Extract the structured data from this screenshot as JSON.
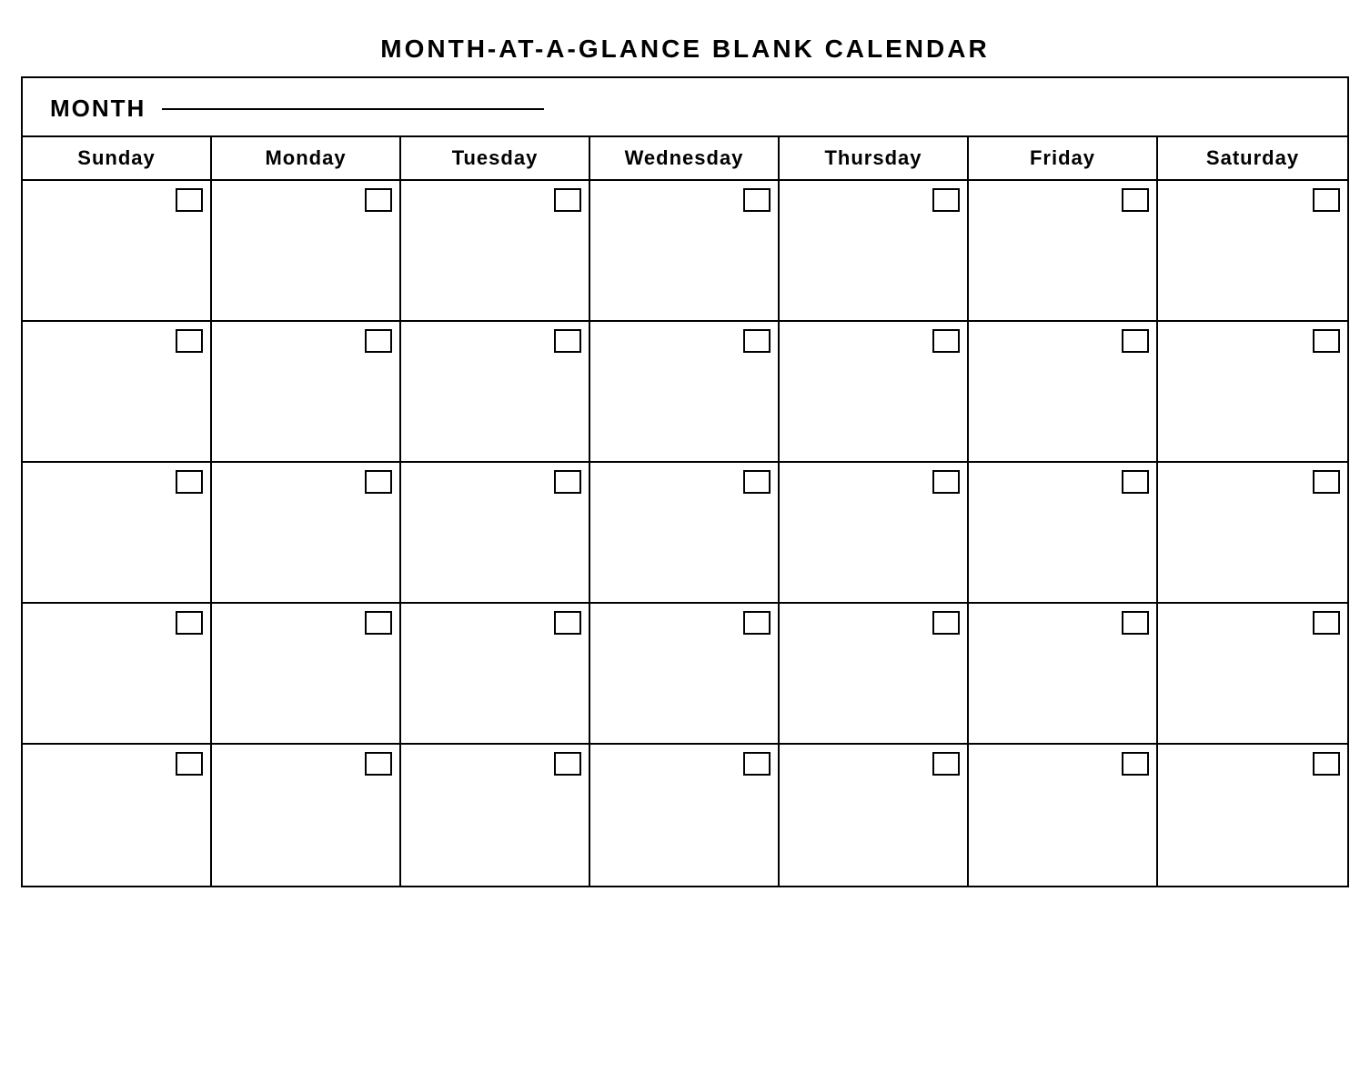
{
  "title": "MONTH-AT-A-GLANCE  BLANK  CALENDAR",
  "month_label": "MONTH",
  "days": [
    {
      "label": "Sunday"
    },
    {
      "label": "Monday"
    },
    {
      "label": "Tuesday"
    },
    {
      "label": "Wednesday"
    },
    {
      "label": "Thursday"
    },
    {
      "label": "Friday"
    },
    {
      "label": "Saturday"
    }
  ],
  "rows": 5,
  "cols": 7
}
